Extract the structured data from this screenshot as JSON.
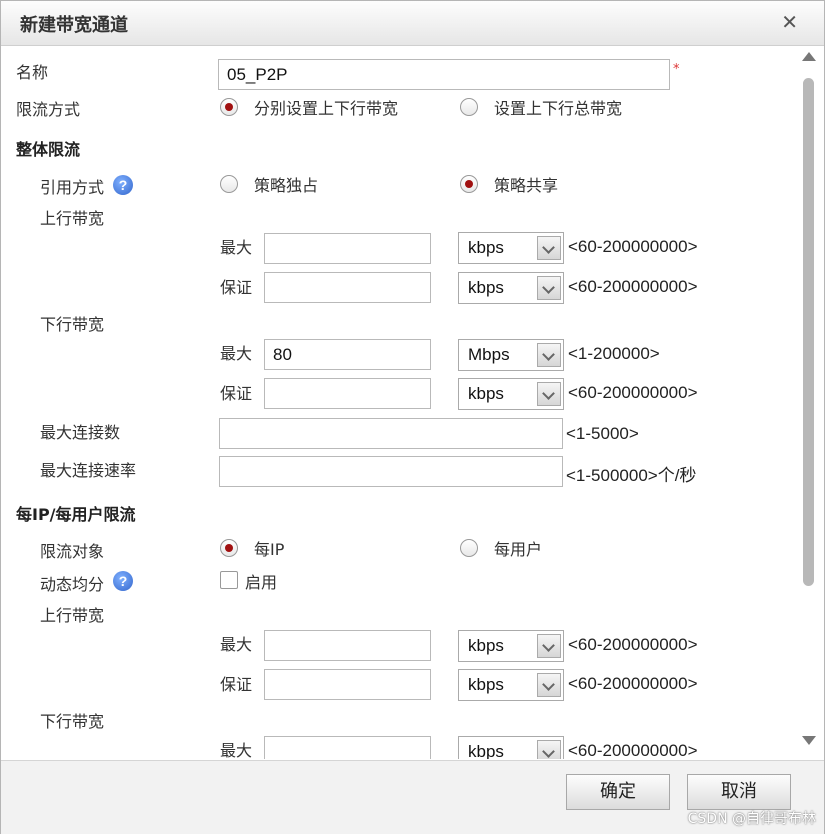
{
  "dialog": {
    "title": "新建带宽通道"
  },
  "form": {
    "name_label": "名称",
    "name_value": "05_P2P",
    "required_mark": "*",
    "limit_mode_label": "限流方式",
    "limit_mode_options": [
      "分别设置上下行带宽",
      "设置上下行总带宽"
    ],
    "limit_mode_selected": 0
  },
  "overall": {
    "title": "整体限流",
    "ref_mode_label": "引用方式",
    "ref_mode_options": [
      "策略独占",
      "策略共享"
    ],
    "ref_mode_selected": 1,
    "up_label": "上行带宽",
    "up_max_label": "最大",
    "up_max_value": "",
    "up_max_unit": "kbps",
    "up_max_range": "<60-200000000>",
    "up_guar_label": "保证",
    "up_guar_value": "",
    "up_guar_unit": "kbps",
    "up_guar_range": "<60-200000000>",
    "down_label": "下行带宽",
    "down_max_label": "最大",
    "down_max_value": "80",
    "down_max_unit": "Mbps",
    "down_max_range": "<1-200000>",
    "down_guar_label": "保证",
    "down_guar_value": "",
    "down_guar_unit": "kbps",
    "down_guar_range": "<60-200000000>",
    "max_conn_label": "最大连接数",
    "max_conn_range": "<1-5000>",
    "max_conn_rate_label": "最大连接速率",
    "max_conn_rate_range": "<1-500000>个/秒"
  },
  "per": {
    "title": "每IP/每用户限流",
    "target_label": "限流对象",
    "target_options": [
      "每IP",
      "每用户"
    ],
    "target_selected": 0,
    "dynamic_label": "动态均分",
    "dynamic_check_label": "启用",
    "dynamic_checked": false,
    "up_label": "上行带宽",
    "up_max_label": "最大",
    "up_max_unit": "kbps",
    "up_max_range": "<60-200000000>",
    "up_guar_label": "保证",
    "up_guar_unit": "kbps",
    "up_guar_range": "<60-200000000>",
    "down_label": "下行带宽",
    "down_max_label": "最大",
    "down_max_unit": "kbps",
    "down_max_range": "<60-200000000>"
  },
  "help_glyph": "?",
  "close_glyph": "✕",
  "footer": {
    "ok_label": "确定",
    "cancel_label": "取消"
  },
  "watermark": "CSDN @自律哥布林"
}
